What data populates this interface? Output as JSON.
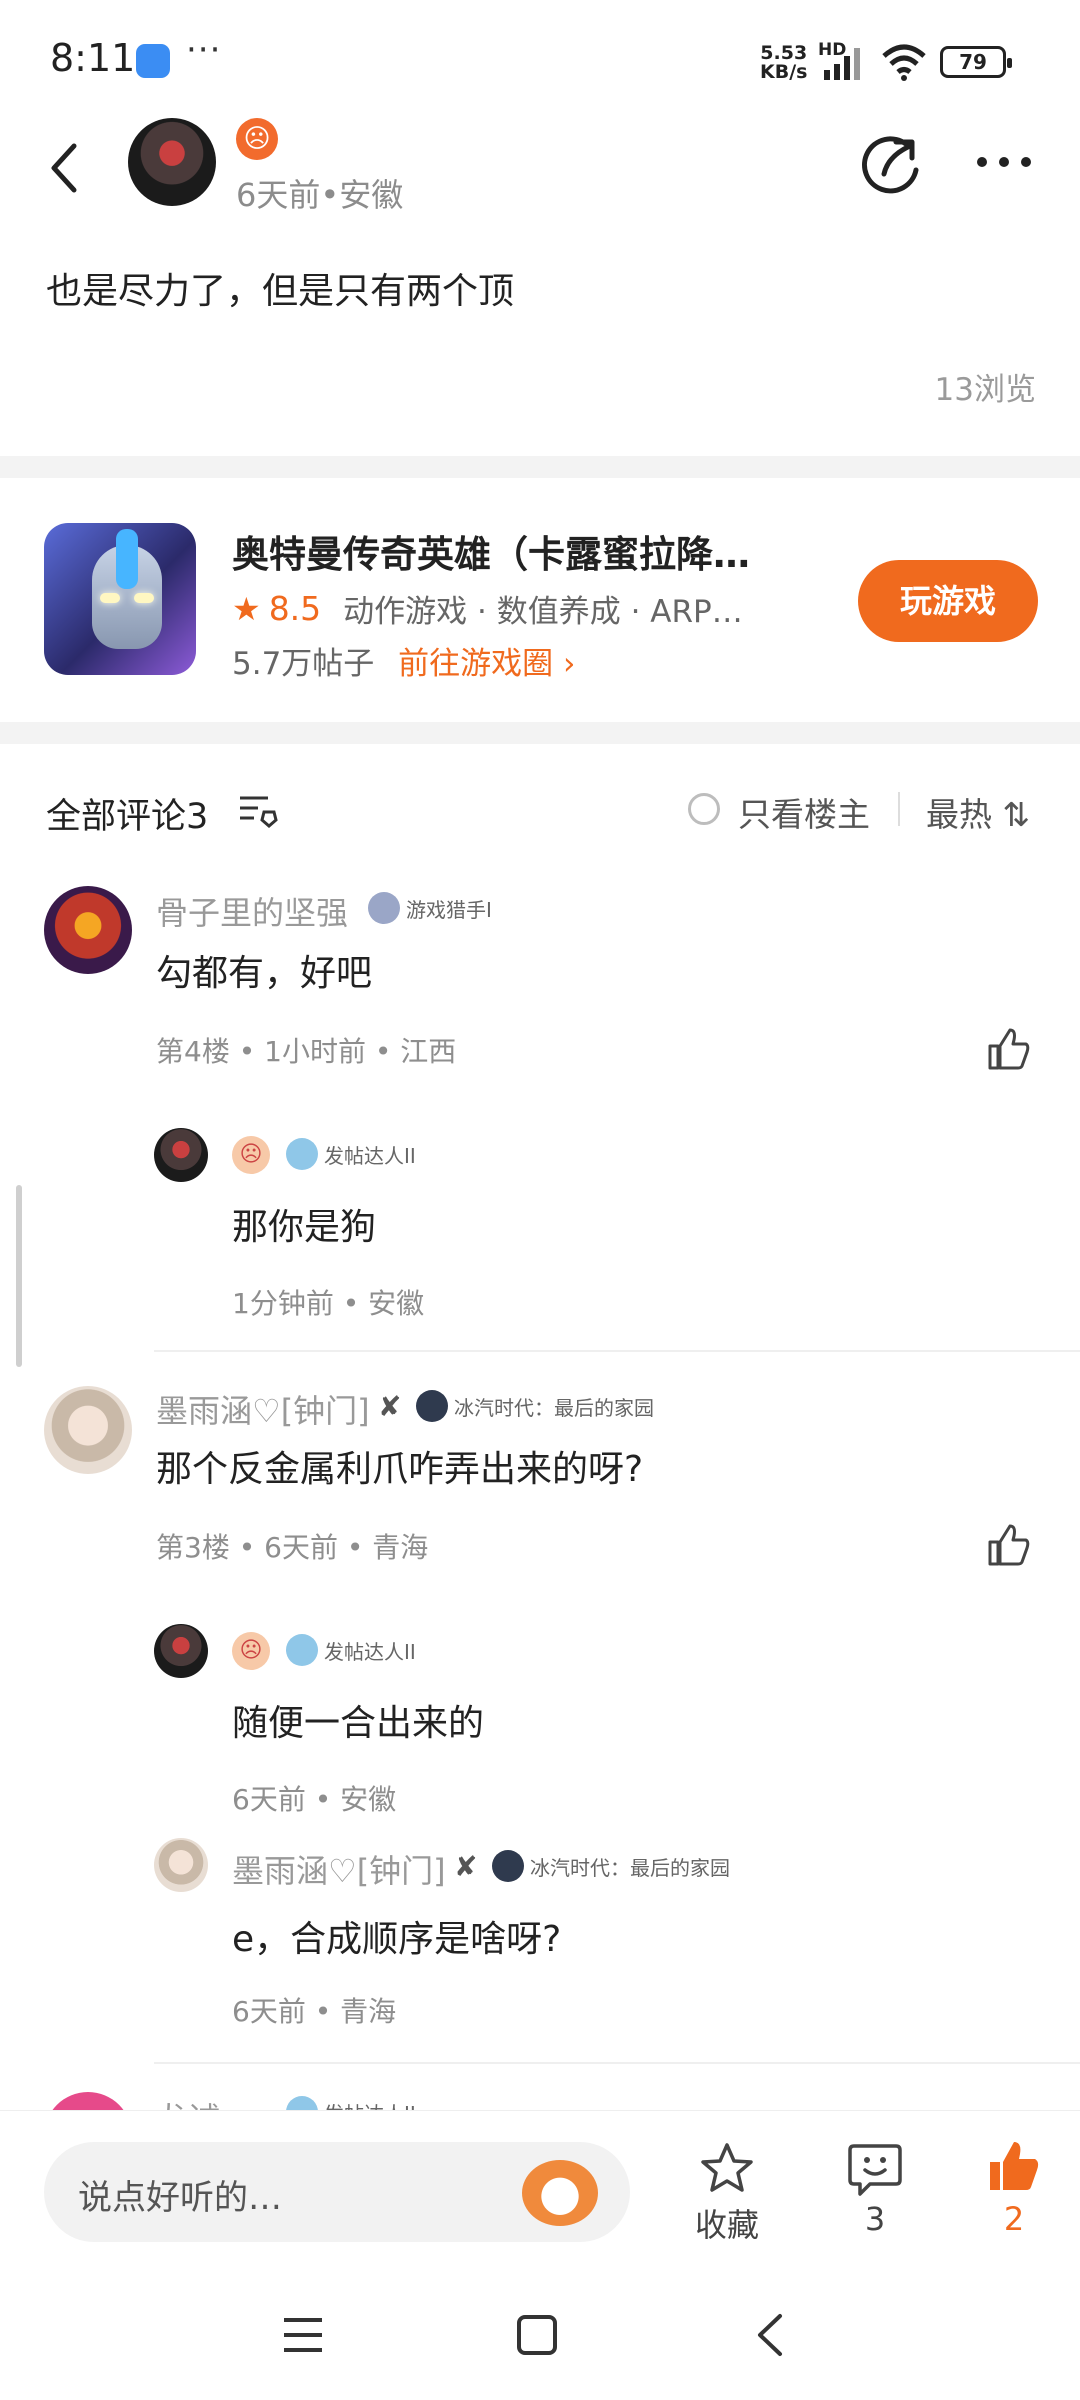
{
  "status_bar": {
    "time": "8:11",
    "more": "···",
    "net_speed_value": "5.53",
    "net_speed_unit": "KB/s",
    "network_label": "HD",
    "battery": "79"
  },
  "post": {
    "meta": "6天前•安徽",
    "text": "也是尽力了，但是只有两个顶",
    "views": "13浏览"
  },
  "game": {
    "title": "奥特曼传奇英雄（卡露蜜拉降…",
    "rating": "8.5",
    "tags": "动作游戏 · 数值养成 · ARP…",
    "posts": "5.7万帖子",
    "link": "前往游戏圈 ›",
    "play_label": "玩游戏"
  },
  "comments_header": {
    "title": "全部评论3",
    "only_host": "只看楼主",
    "sort": "最热 ⇅"
  },
  "comments": [
    {
      "name": "骨子里的坚强",
      "badge": "游戏猎手I",
      "text": "勾都有，好吧",
      "meta": "第4楼 • 1小时前 • 江西",
      "replies": [
        {
          "badge": "发帖达人II",
          "text": "那你是狗",
          "meta": "1分钟前 • 安徽"
        }
      ]
    },
    {
      "name": "墨雨涵♡[钟门]",
      "badge": "冰汽时代：最后的家园",
      "text": "那个反金属利爪咋弄出来的呀?",
      "meta": "第3楼 • 6天前 • 青海",
      "replies": [
        {
          "badge": "发帖达人II",
          "text": "随便一合出来的",
          "meta": "6天前 • 安徽"
        },
        {
          "name": "墨雨涵♡[钟门]",
          "badge": "冰汽时代：最后的家园",
          "text": "e，合成顺序是啥呀?",
          "meta": "6天前 • 青海"
        }
      ]
    },
    {
      "name": "龙诚",
      "badge": "发帖达人II"
    }
  ],
  "bottom_bar": {
    "placeholder": "说点好听的…",
    "favorite": "收藏",
    "comment_count": "3",
    "like_count": "2"
  },
  "colors": {
    "accent": "#f06a1e",
    "text": "#222222",
    "muted": "#999999"
  }
}
